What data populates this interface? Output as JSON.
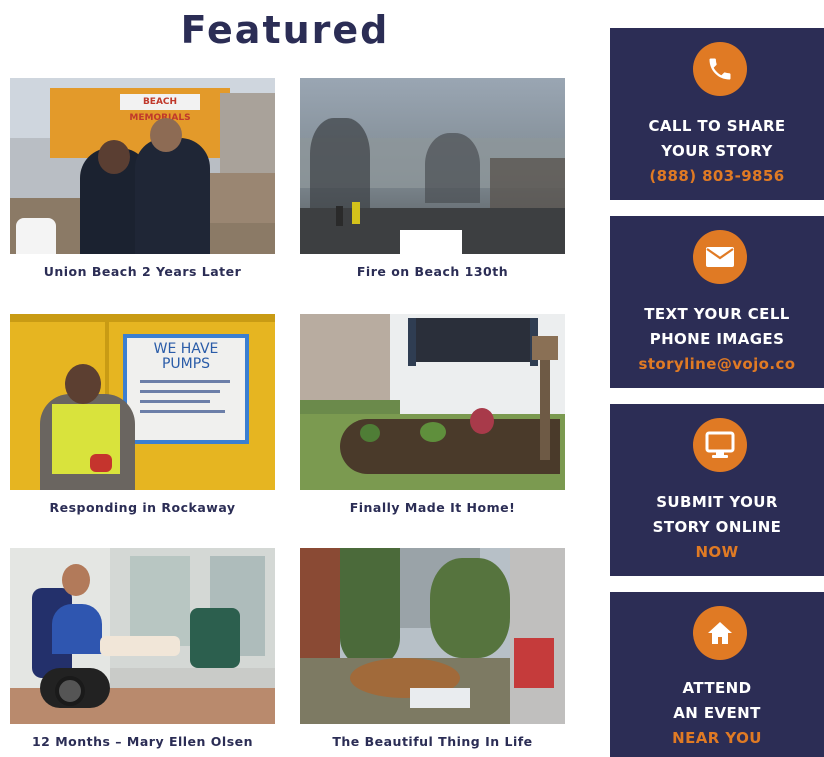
{
  "heading": "Featured",
  "featured": [
    {
      "caption": "Union Beach 2 Years Later",
      "sign_text": "BEACH MEMORIALS"
    },
    {
      "caption": "Fire on Beach 130th"
    },
    {
      "caption": "Responding in Rockaway",
      "sign_text": "WE HAVE PUMPS"
    },
    {
      "caption": "Finally Made It Home!"
    },
    {
      "caption": "12 Months – Mary Ellen Olsen"
    },
    {
      "caption": "The Beautiful Thing In Life"
    }
  ],
  "cta": [
    {
      "icon": "phone-icon",
      "lines": [
        "CALL TO SHARE",
        "YOUR STORY"
      ],
      "accent": "(888) 803-9856"
    },
    {
      "icon": "envelope-icon",
      "lines": [
        "TEXT YOUR CELL",
        "PHONE IMAGES"
      ],
      "accent": "storyline@vojo.co"
    },
    {
      "icon": "monitor-icon",
      "lines": [
        "SUBMIT YOUR",
        "STORY ONLINE"
      ],
      "accent": "NOW"
    },
    {
      "icon": "home-icon",
      "lines": [
        "ATTEND",
        "AN EVENT"
      ],
      "accent": "NEAR YOU"
    }
  ],
  "colors": {
    "navy": "#2c2d55",
    "accent": "#e07a24"
  }
}
